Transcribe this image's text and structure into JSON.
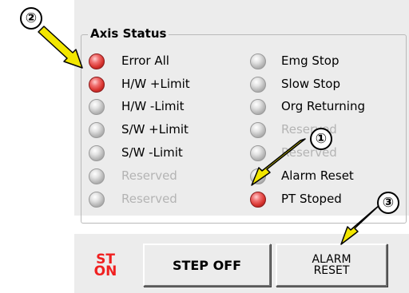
{
  "axis_status": {
    "title": "Axis Status",
    "left": [
      {
        "label": "Error All",
        "state": "on"
      },
      {
        "label": "H/W +Limit",
        "state": "on"
      },
      {
        "label": "H/W -Limit",
        "state": "off"
      },
      {
        "label": "S/W +Limit",
        "state": "off"
      },
      {
        "label": "S/W -Limit",
        "state": "off"
      },
      {
        "label": "Reserved",
        "state": "off",
        "disabled": true
      },
      {
        "label": "Reserved",
        "state": "off",
        "disabled": true
      }
    ],
    "right": [
      {
        "label": "Emg Stop",
        "state": "off"
      },
      {
        "label": "Slow Stop",
        "state": "off"
      },
      {
        "label": "Org Returning",
        "state": "off"
      },
      {
        "label": "Reserved",
        "state": "off",
        "disabled": true
      },
      {
        "label": "Reserved",
        "state": "off",
        "disabled": true
      },
      {
        "label": "Alarm Reset",
        "state": "off"
      },
      {
        "label": "PT Stoped",
        "state": "on"
      }
    ]
  },
  "servo_indicator": {
    "line1": "ST",
    "line2": "ON"
  },
  "buttons": {
    "step_off": "STEP OFF",
    "alarm_reset_line1": "ALARM",
    "alarm_reset_line2": "RESET"
  },
  "callouts": {
    "one": "①",
    "two": "②",
    "three": "③"
  },
  "colors": {
    "led_on": "#d8342f",
    "led_off": "#bcbcbc",
    "arrow": "#f2e600",
    "st_on": "#f02020",
    "panel": "#ececec"
  }
}
